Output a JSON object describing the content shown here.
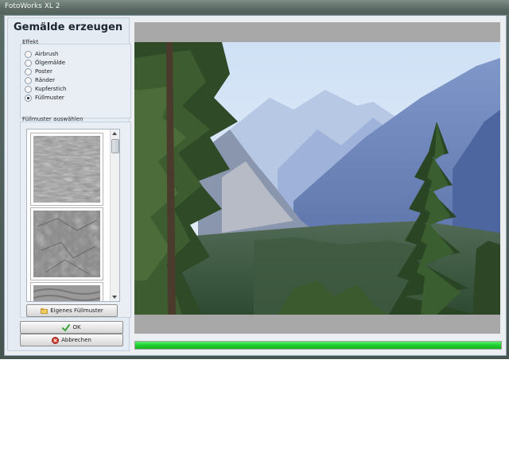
{
  "window": {
    "title": "FotoWorks XL 2"
  },
  "panel": {
    "title": "Gemälde erzeugen",
    "effekt_label": "Effekt",
    "effects": [
      {
        "label": "Airbrush",
        "checked": false
      },
      {
        "label": "Ölgemälde",
        "checked": false
      },
      {
        "label": "Poster",
        "checked": false
      },
      {
        "label": "Ränder",
        "checked": false
      },
      {
        "label": "Kupferstich",
        "checked": false
      },
      {
        "label": "Füllmuster",
        "checked": true
      }
    ],
    "fill_pattern_label": "Füllmuster auswählen",
    "own_pattern_button": "Eigenes Füllmuster",
    "ok_button": "OK",
    "cancel_button": "Abbrechen"
  },
  "progress": {
    "fraction": 1.0
  },
  "colors": {
    "progress_green": "#1fcf2e",
    "panel_bg": "#e5ebf3",
    "preview_gray": "#a8a8a8"
  }
}
